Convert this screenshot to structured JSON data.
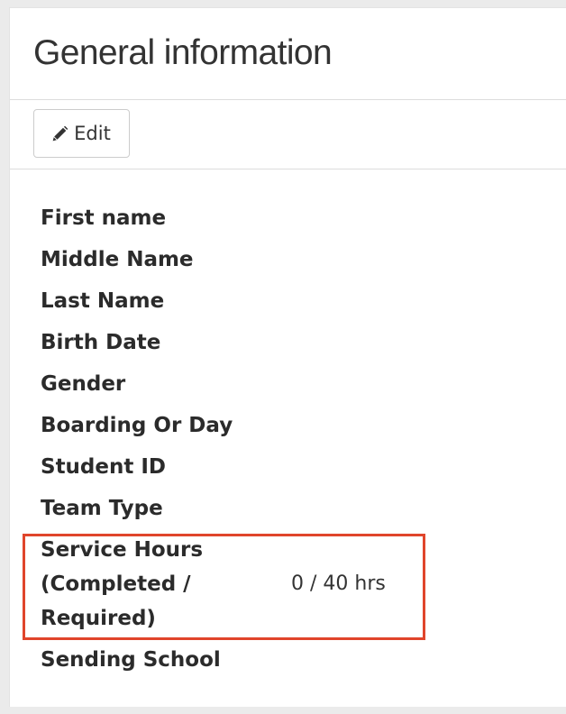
{
  "panel": {
    "title": "General information",
    "edit_button": {
      "label": "Edit",
      "icon": "pencil-icon"
    }
  },
  "fields": [
    {
      "label": "First name",
      "value": ""
    },
    {
      "label": "Middle Name",
      "value": ""
    },
    {
      "label": "Last Name",
      "value": ""
    },
    {
      "label": "Birth Date",
      "value": ""
    },
    {
      "label": "Gender",
      "value": ""
    },
    {
      "label": "Boarding Or Day",
      "value": ""
    },
    {
      "label": "Student ID",
      "value": ""
    },
    {
      "label": "Team Type",
      "value": ""
    },
    {
      "label": "Service Hours (Completed / Required)",
      "value": "0 / 40 hrs"
    },
    {
      "label": "Sending School",
      "value": ""
    }
  ],
  "highlight": {
    "color": "#e0452b",
    "target": "Service Hours (Completed / Required)"
  }
}
